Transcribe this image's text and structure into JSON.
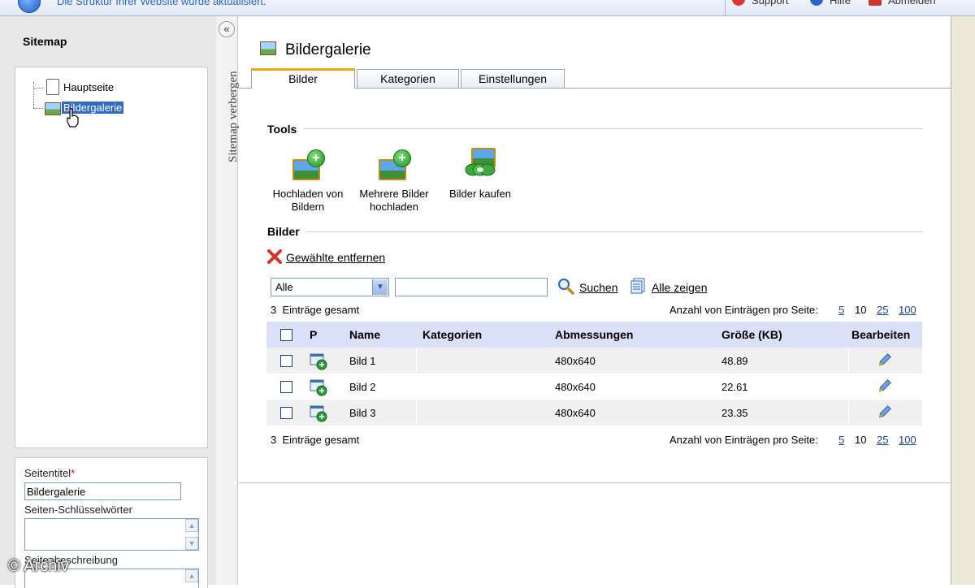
{
  "topbar": {
    "message": "Die Struktur Ihrer Website wurde aktualisiert.",
    "actions": [
      {
        "label": "Support",
        "icon": "lifebuoy-icon"
      },
      {
        "label": "Hilfe",
        "icon": "help-icon"
      },
      {
        "label": "Abmelden",
        "icon": "logout-icon"
      }
    ]
  },
  "sidebar": {
    "title": "Sitemap",
    "collapse_label": "Sitemap verbergen",
    "tree": [
      {
        "label": "Hauptseite",
        "icon": "page-icon"
      },
      {
        "label": "Bildergalerie",
        "icon": "gallery-icon",
        "selected": true
      }
    ],
    "props": {
      "title_label": "Seitentitel",
      "title_required": "*",
      "title_value": "Bildergalerie",
      "keywords_label": "Seiten-Schlüsselwörter",
      "description_label": "Seitenbeschreibung"
    }
  },
  "main": {
    "page_title": "Bildergalerie",
    "tabs": [
      {
        "label": "Bilder",
        "active": true
      },
      {
        "label": "Kategorien",
        "active": false
      },
      {
        "label": "Einstellungen",
        "active": false
      }
    ],
    "tools_heading": "Tools",
    "tools": [
      {
        "line1": "Hochladen von",
        "line2": "Bildern",
        "icon": "upload-image-icon"
      },
      {
        "line1": "Mehrere Bilder",
        "line2": "hochladen",
        "icon": "upload-multiple-images-icon"
      },
      {
        "line1": "Bilder kaufen",
        "line2": "",
        "icon": "buy-images-icon"
      }
    ],
    "images_heading": "Bilder",
    "remove_selected": "Gewählte entfernen",
    "filter": {
      "select_value": "Alle",
      "search_value": "",
      "search_label": "Suchen",
      "show_all_label": "Alle zeigen"
    },
    "pager": {
      "total_count": "3",
      "total_label": "Einträge gesamt",
      "per_page_label": "Anzahl von Einträgen pro Seite:",
      "options": [
        "5",
        "10",
        "25",
        "100"
      ],
      "current": "10"
    },
    "table": {
      "headers": [
        "P",
        "Name",
        "Kategorien",
        "Abmessungen",
        "Größe (KB)",
        "Bearbeiten"
      ],
      "rows": [
        {
          "name": "Bild 1",
          "categories": "",
          "dimensions": "480x640",
          "size": "48.89"
        },
        {
          "name": "Bild 2",
          "categories": "",
          "dimensions": "480x640",
          "size": "22.61"
        },
        {
          "name": "Bild 3",
          "categories": "",
          "dimensions": "480x640",
          "size": "23.35"
        }
      ]
    }
  },
  "watermark": "© Archiv",
  "colors": {
    "header_row": "#d9e0f7",
    "row_alt": "#f0f0f0",
    "tab_accent": "#f2a516",
    "selection": "#316ac5"
  }
}
